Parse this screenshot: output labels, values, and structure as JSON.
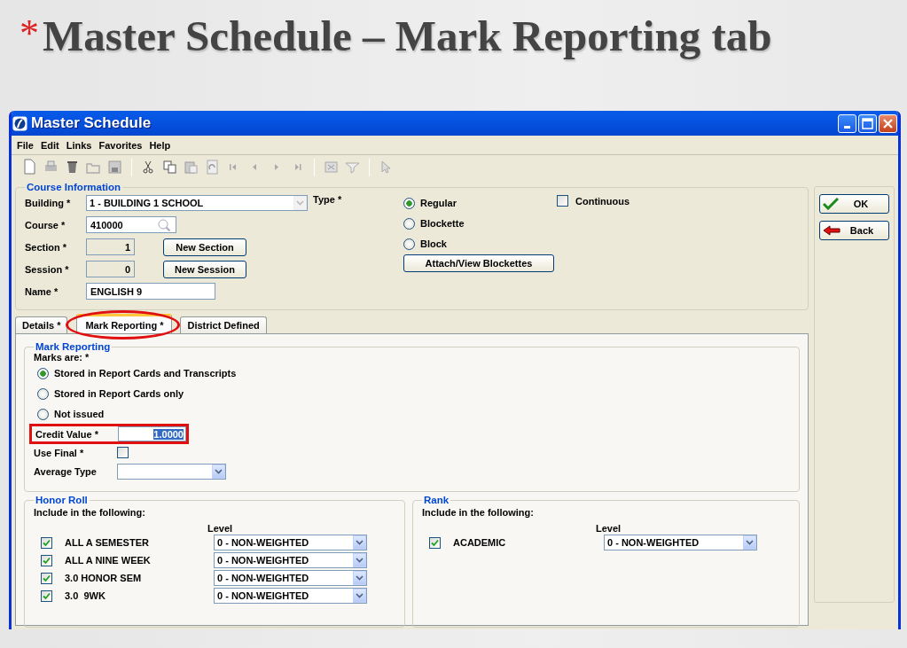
{
  "slide": {
    "bullet": "*",
    "title": "Master Schedule – Mark Reporting tab"
  },
  "window": {
    "title": "Master Schedule"
  },
  "menu": [
    "File",
    "Edit",
    "Links",
    "Favorites",
    "Help"
  ],
  "course_information": {
    "title": "Course Information",
    "fields": [
      {
        "label": "Building *",
        "value": "1 - BUILDING 1 SCHOOL",
        "kind": "dropdown"
      },
      {
        "label": "Course *",
        "value": "410000",
        "kind": "lookup"
      },
      {
        "label": "Section *",
        "value": "1",
        "kind": "readonly",
        "button": "New Section"
      },
      {
        "label": "Session *",
        "value": "0",
        "kind": "readonly",
        "button": "New Session"
      },
      {
        "label": "Name *",
        "value": "ENGLISH 9",
        "kind": "text"
      }
    ],
    "type_label": "Type *",
    "type_options": [
      {
        "label": "Regular",
        "selected": true
      },
      {
        "label": "Blockette",
        "selected": false
      },
      {
        "label": "Block",
        "selected": false
      }
    ],
    "attach_button": "Attach/View Blockettes",
    "continuous": {
      "label": "Continuous",
      "checked": false
    }
  },
  "side_buttons": [
    {
      "label": "OK",
      "kind": "ok"
    },
    {
      "label": "Back",
      "kind": "back"
    }
  ],
  "tabs": [
    {
      "label": "Details *",
      "selected": false,
      "highlighted": false
    },
    {
      "label": "Mark Reporting *",
      "selected": true,
      "highlighted": true
    },
    {
      "label": "District Defined",
      "selected": false,
      "highlighted": false
    }
  ],
  "mark_reporting": {
    "title": "Mark Reporting",
    "marks_label": "Marks are: *",
    "options": [
      {
        "label": "Stored in Report Cards and Transcripts",
        "selected": true
      },
      {
        "label": "Stored in Report Cards only",
        "selected": false
      },
      {
        "label": "Not issued",
        "selected": false
      }
    ],
    "credit_value": {
      "label": "Credit Value *",
      "value": "1.0000",
      "text_selected": true,
      "highlighted": true
    },
    "use_final": {
      "label": "Use Final *",
      "checked": false
    },
    "average_type": {
      "label": "Average Type"
    }
  },
  "honor_roll": {
    "title": "Honor Roll",
    "intro": "Include in the following:",
    "level_header": "Level",
    "rows": [
      {
        "name": "ALL A SEMESTER",
        "checked": true,
        "level_value": "0 - NON-WEIGHTED"
      },
      {
        "name": "ALL A NINE WEEK",
        "checked": true,
        "level_value": "0 - NON-WEIGHTED"
      },
      {
        "name": "3.0 HONOR SEM",
        "checked": true,
        "level_value": "0 - NON-WEIGHTED"
      },
      {
        "name": "3.0  9WK",
        "checked": true,
        "level_value": "0 - NON-WEIGHTED"
      }
    ]
  },
  "rank": {
    "title": "Rank",
    "intro": "Include in the following:",
    "level_header": "Level",
    "rows": [
      {
        "name": "ACADEMIC",
        "checked": true,
        "level_value": "0 - NON-WEIGHTED"
      }
    ]
  }
}
